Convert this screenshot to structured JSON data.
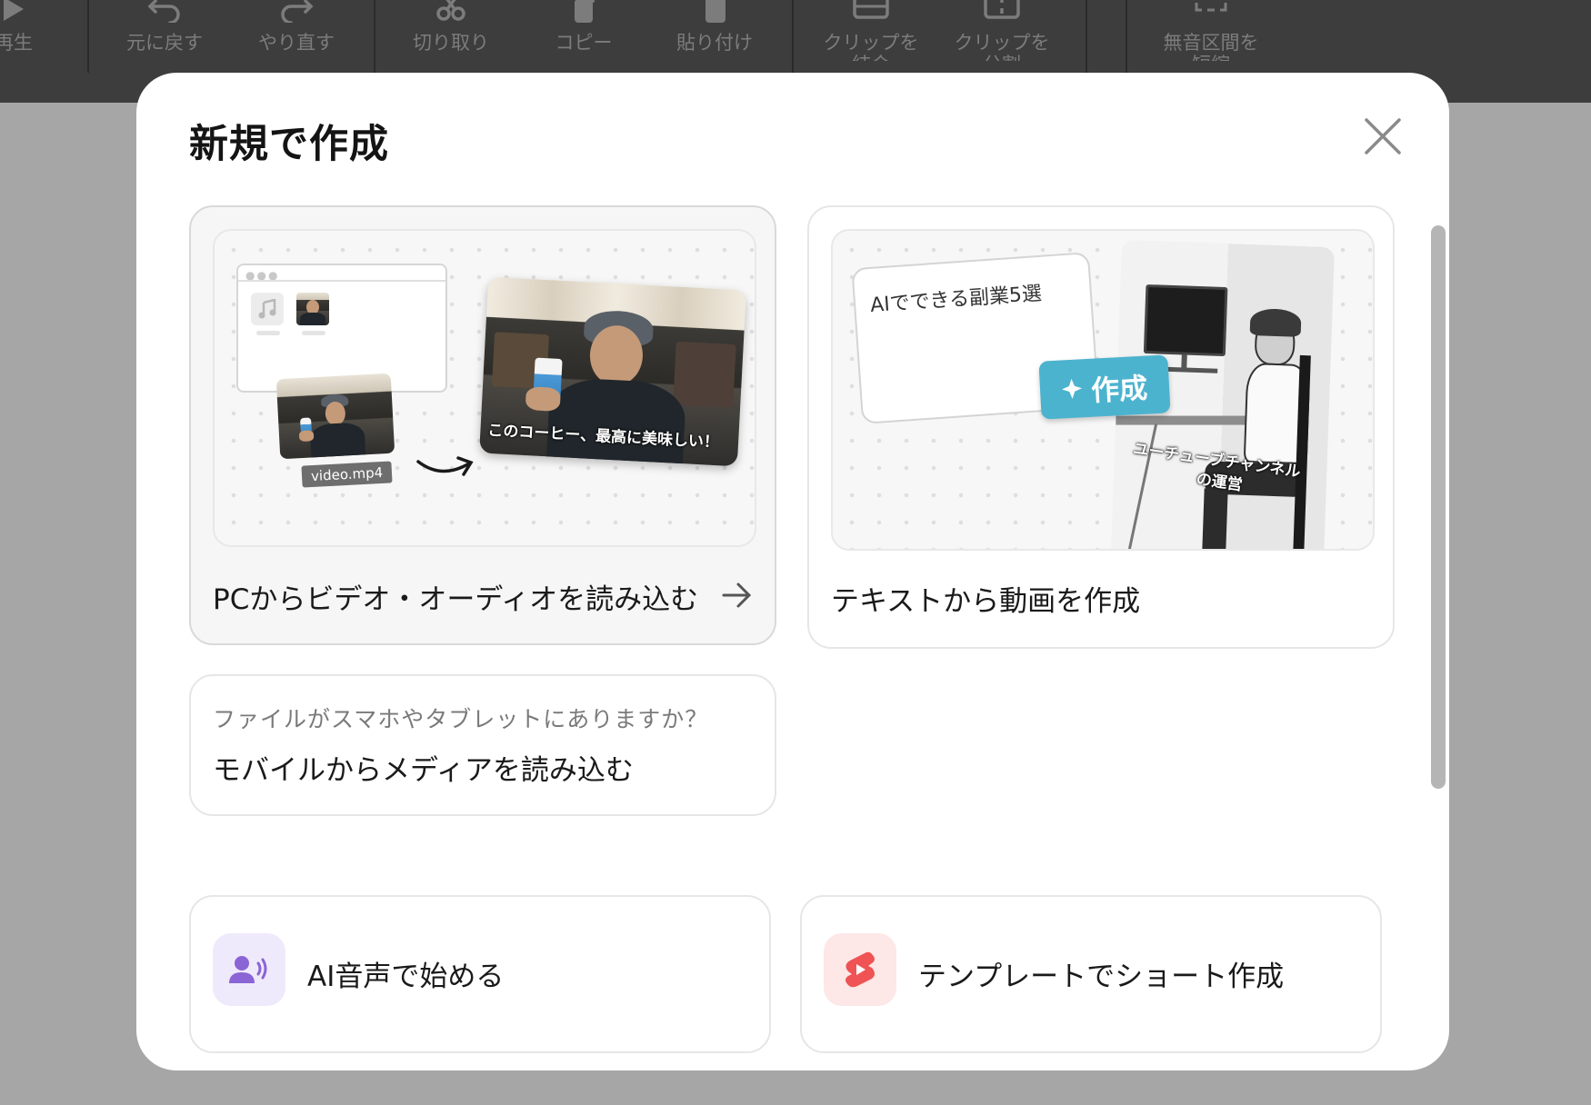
{
  "toolbar": {
    "items": [
      {
        "label": "再生",
        "icon": "play-icon"
      },
      {
        "label": "元に戻す",
        "icon": "undo-icon"
      },
      {
        "label": "やり直す",
        "icon": "redo-icon"
      },
      {
        "label": "切り取り",
        "icon": "scissors-icon"
      },
      {
        "label": "コピー",
        "icon": "copy-icon"
      },
      {
        "label": "貼り付け",
        "icon": "paste-icon"
      },
      {
        "label": "クリップを\n結合",
        "icon": "merge-icon"
      },
      {
        "label": "クリップを\n分割",
        "icon": "split-icon"
      },
      {
        "label": "無音区間を\n短縮",
        "icon": "trim-silence-icon"
      }
    ]
  },
  "modal": {
    "title": "新規で作成",
    "cards": {
      "import_pc": {
        "label": "PCからビデオ・オーディオを読み込む",
        "file_name": "video.mp4",
        "caption": "このコーヒー、最高に美味しい！"
      },
      "text_to_video": {
        "label": "テキストから動画を作成",
        "prompt_text": "AIでできる副業5選",
        "create_button": "作成",
        "overlay_text_1": "ユーチューブチャンネル",
        "overlay_text_2": "の運営"
      },
      "mobile": {
        "sub_label": "ファイルがスマホやタブレットにありますか？",
        "label": "モバイルからメディアを読み込む"
      },
      "ai_voice": {
        "label": "AI音声で始める",
        "icon": "ai-voice-icon"
      },
      "template_short": {
        "label": "テンプレートでショート作成",
        "icon": "shorts-icon"
      }
    }
  },
  "colors": {
    "accent_create": "#4cb3cf",
    "voice_tile": "#efeafb",
    "voice_icon": "#8b64d6",
    "shorts_tile": "#fde7e7",
    "shorts_icon": "#ef5353"
  }
}
